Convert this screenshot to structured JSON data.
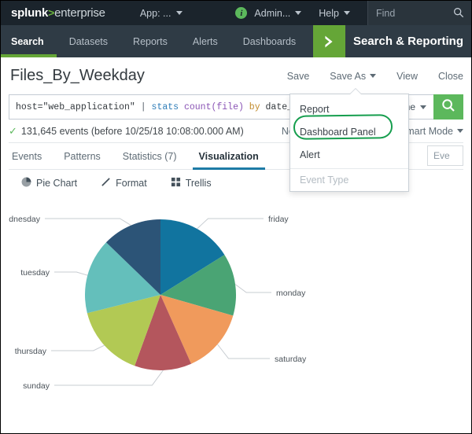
{
  "topbar": {
    "logo_bold": "splunk",
    "logo_chevron": ">",
    "logo_light": "enterprise",
    "app_label": "App: ...",
    "info_glyph": "i",
    "admin_label": "Admin...",
    "help_label": "Help",
    "find_placeholder": "Find"
  },
  "nav": {
    "items": [
      {
        "label": "Search",
        "active": true
      },
      {
        "label": "Datasets",
        "active": false
      },
      {
        "label": "Reports",
        "active": false
      },
      {
        "label": "Alerts",
        "active": false
      },
      {
        "label": "Dashboards",
        "active": false
      }
    ],
    "app_name": "Search & Reporting",
    "app_icon": "chevron-right-icon"
  },
  "title": {
    "page_title": "Files_By_Weekday",
    "actions": [
      {
        "label": "Save",
        "caret": false
      },
      {
        "label": "Save As",
        "caret": true
      },
      {
        "label": "View",
        "caret": false
      },
      {
        "label": "Close",
        "caret": false
      }
    ]
  },
  "search": {
    "query_tokens": [
      {
        "text": "host=\"web_application\"",
        "type": "plain"
      },
      {
        "text": "|",
        "type": "pipe"
      },
      {
        "text": "stats",
        "type": "cmd"
      },
      {
        "text": "count(file)",
        "type": "fn"
      },
      {
        "text": "by",
        "type": "by"
      },
      {
        "text": "date_wd",
        "type": "plain"
      }
    ],
    "query_value": "host=\"web_application\" | stats count(file) by date_wd",
    "time_range": "All time",
    "search_icon": "magnifier-icon"
  },
  "status": {
    "check_glyph": "✓",
    "event_count_text": "131,645 events (before 10/25/18 10:08:00.000 AM)",
    "sampling_label": "No Event Sampling",
    "mode_label": "Smart Mode"
  },
  "result_tabs": {
    "items": [
      {
        "label": "Events",
        "active": false
      },
      {
        "label": "Patterns",
        "active": false
      },
      {
        "label": "Statistics (7)",
        "active": false
      },
      {
        "label": "Visualization",
        "active": true
      }
    ],
    "right_field": "Eve"
  },
  "viz_toolbar": {
    "items": [
      {
        "label": "Pie Chart",
        "icon": "pie-chart-icon"
      },
      {
        "label": "Format",
        "icon": "pencil-icon"
      },
      {
        "label": "Trellis",
        "icon": "grid-icon"
      }
    ]
  },
  "save_as_menu": {
    "items": [
      {
        "label": "Report",
        "disabled": false,
        "highlighted": false
      },
      {
        "label": "Dashboard Panel",
        "disabled": false,
        "highlighted": true
      },
      {
        "label": "Alert",
        "disabled": false,
        "highlighted": false
      },
      {
        "label": "Event Type",
        "disabled": true,
        "highlighted": false
      }
    ],
    "highlight_color": "#169e4e"
  },
  "chart_data": {
    "type": "pie",
    "title": "",
    "categories": [
      "friday",
      "monday",
      "saturday",
      "sunday",
      "thursday",
      "tuesday",
      "wednesday"
    ],
    "values": [
      58,
      48,
      50,
      44,
      56,
      58,
      46
    ],
    "unit": "degrees",
    "percentages": [
      16.1,
      13.3,
      13.9,
      12.2,
      15.6,
      16.1,
      12.8
    ],
    "colors": [
      "#11749f",
      "#4aa474",
      "#f09a5c",
      "#b4565d",
      "#b2c954",
      "#64bfbb",
      "#2c5477"
    ],
    "start_angle_deg": 0,
    "direction": "clockwise",
    "labels_shown": true,
    "legend": "none",
    "leader_lines": true,
    "xlabel": "",
    "ylabel": ""
  }
}
